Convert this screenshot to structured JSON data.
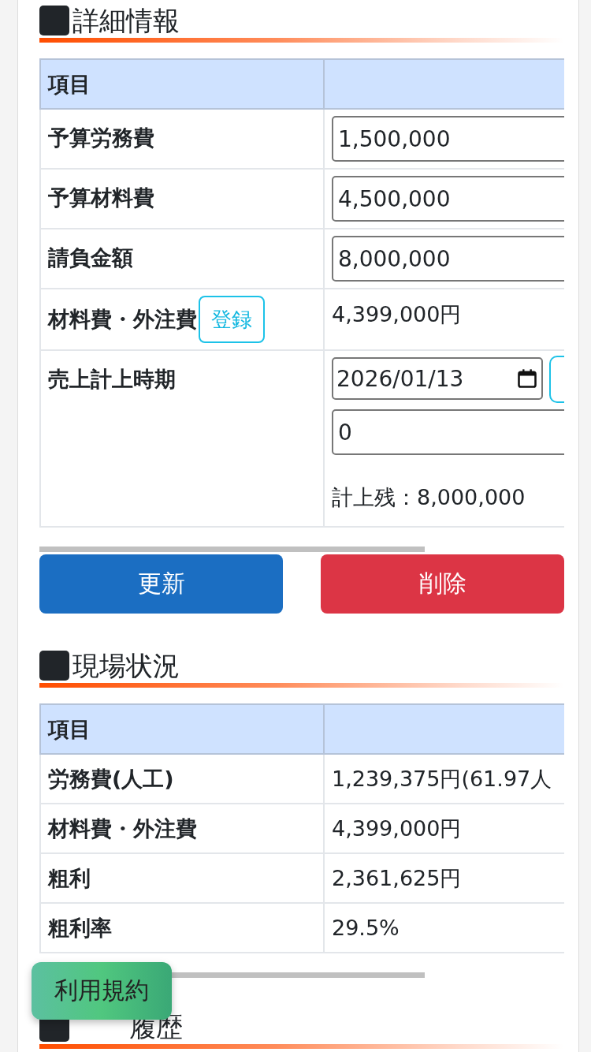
{
  "sections": [
    {
      "title": "詳細情報",
      "table": {
        "header": "項目",
        "rows": [
          {
            "kind": "input",
            "label": "予算労務費",
            "value": "1,500,000"
          },
          {
            "kind": "input",
            "label": "予算材料費",
            "value": "4,500,000"
          },
          {
            "kind": "input",
            "label": "請負金額",
            "value": "8,000,000"
          },
          {
            "kind": "text",
            "label": "材料費・外注費",
            "button": "登録",
            "value": "4,399,000円"
          },
          {
            "kind": "sales",
            "label": "売上計上時期",
            "date": "2026/01/13",
            "value": "0",
            "note": "計上残：8,000,000"
          }
        ]
      },
      "buttons": [
        {
          "label": "更新",
          "kind": "primary"
        },
        {
          "label": "削除",
          "kind": "danger"
        }
      ]
    },
    {
      "title": "現場状況",
      "table": {
        "header": "項目",
        "rows": [
          {
            "kind": "plain",
            "label": "労務費(人工)",
            "value": "1,239,375円(61.97人"
          },
          {
            "kind": "plain",
            "label": "材料費・外注費",
            "value": "4,399,000円"
          },
          {
            "kind": "plain",
            "label": "粗利",
            "value": "2,361,625円"
          },
          {
            "kind": "plain",
            "label": "粗利率",
            "value": "29.5%"
          }
        ]
      }
    },
    {
      "title": "履歴"
    }
  ],
  "floating_button": {
    "label": "利用規約"
  }
}
